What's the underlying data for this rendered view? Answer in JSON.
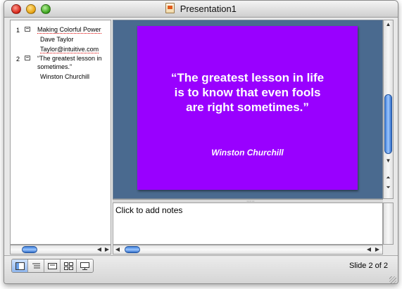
{
  "window": {
    "title": "Presentation1"
  },
  "outline": {
    "slides": [
      {
        "number": "1",
        "lines": [
          "Making Colorful Power",
          "Dave Taylor",
          "Taylor@intuitive.com"
        ]
      },
      {
        "number": "2",
        "lines": [
          "“The greatest lesson in",
          "sometimes.”",
          "Winston Churchill"
        ]
      }
    ]
  },
  "slide": {
    "quote_lines": [
      "“The greatest lesson in life",
      "is to know that even fools",
      "are right sometimes.”"
    ],
    "author": "Winston Churchill",
    "background_color": "#9900ff"
  },
  "notes": {
    "placeholder": "Click to add notes"
  },
  "view_buttons": [
    {
      "icon": "normal-view-icon",
      "active": true
    },
    {
      "icon": "outline-view-icon",
      "active": false
    },
    {
      "icon": "slide-view-icon",
      "active": false
    },
    {
      "icon": "slide-sorter-icon",
      "active": false
    },
    {
      "icon": "slide-show-icon",
      "active": false
    }
  ],
  "status": {
    "slide_indicator": "Slide 2 of 2"
  }
}
